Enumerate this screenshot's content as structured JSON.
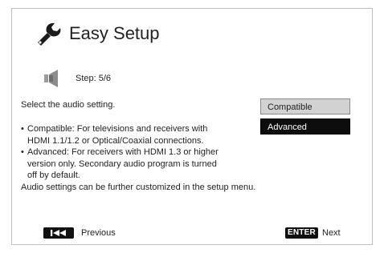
{
  "header": {
    "title": "Easy Setup",
    "icon": "wrench-icon"
  },
  "step": {
    "icon": "speaker-icon",
    "label": "Step: 5/6"
  },
  "prompt": "Select the audio setting.",
  "description": {
    "bullet_1_line_1": "Compatible: For televisions and receivers with",
    "bullet_1_line_2": "HDMI 1.1/1.2 or Optical/Coaxial connections.",
    "bullet_2_line_1": "Advanced: For receivers with HDMI 1.3 or higher",
    "bullet_2_line_2": "version only. Secondary audio program is turned",
    "bullet_2_line_3": "off by default.",
    "footer_note": "Audio settings can be further customized in the setup menu.",
    "bullet_char": "•"
  },
  "options": [
    {
      "label": "Compatible",
      "selected": false
    },
    {
      "label": "Advanced",
      "selected": true
    }
  ],
  "navigation": {
    "previous_label": "Previous",
    "previous_icon": "skip-previous-icon",
    "enter_key": "ENTER",
    "next_label": "Next"
  },
  "colors": {
    "selected_bg": "#0d0d0d",
    "selected_text": "#ffffff",
    "option_bg": "#d2d2d2",
    "frame_border": "#bdbdbd"
  }
}
